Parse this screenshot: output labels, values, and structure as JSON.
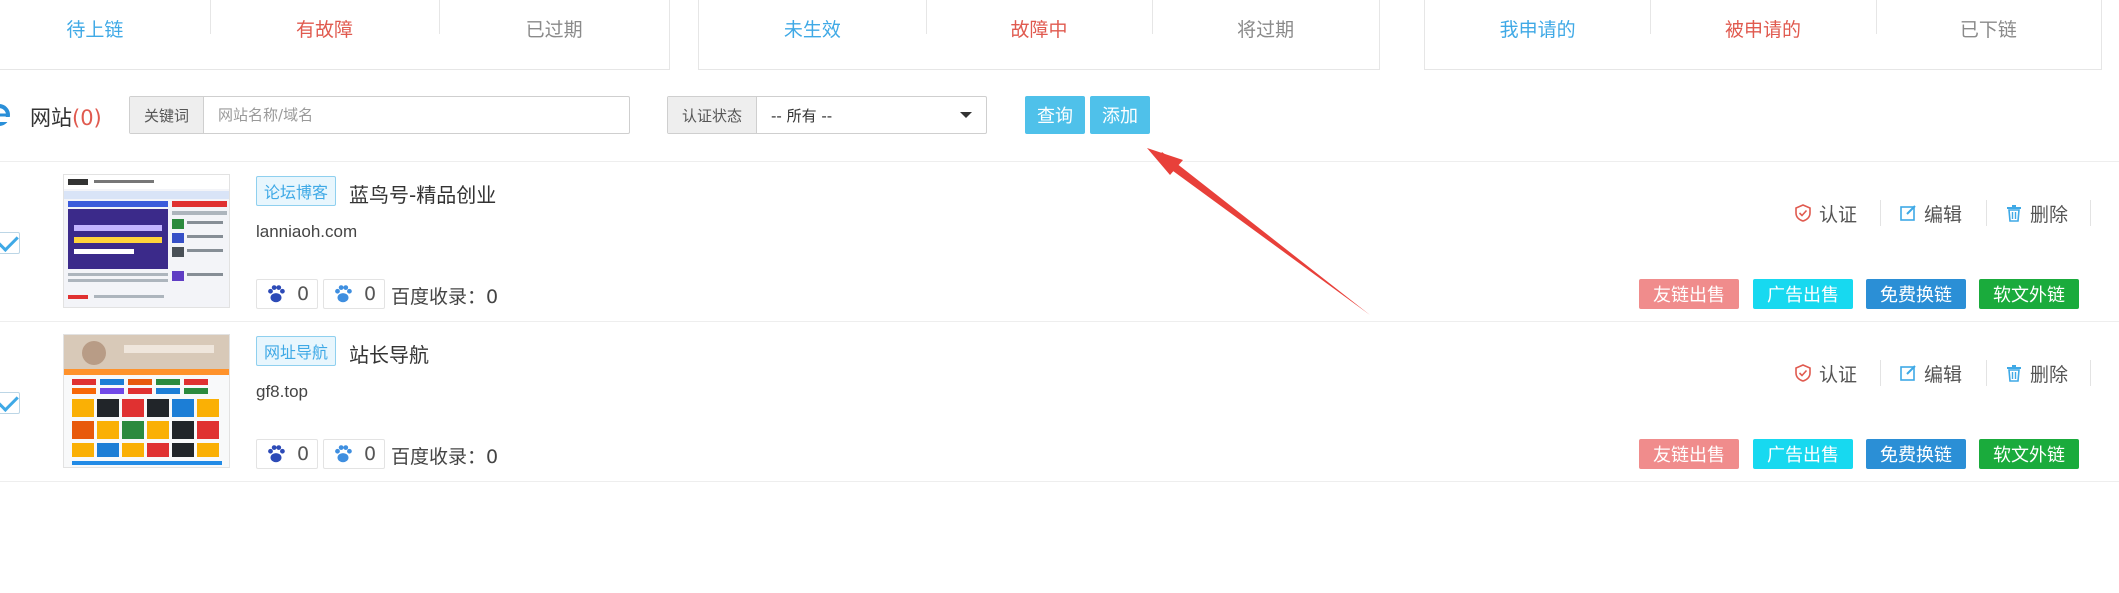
{
  "status_panels": [
    {
      "items": [
        {
          "label": "待上链",
          "color": "#3fa9e6"
        },
        {
          "label": "有故障",
          "color": "#e05a4f"
        },
        {
          "label": "已过期",
          "color": "#8a8a8a"
        }
      ]
    },
    {
      "items": [
        {
          "label": "未生效",
          "color": "#3fa9e6"
        },
        {
          "label": "故障中",
          "color": "#e05a4f"
        },
        {
          "label": "将过期",
          "color": "#8a8a8a"
        }
      ]
    },
    {
      "items": [
        {
          "label": "我申请的",
          "color": "#3fa9e6"
        },
        {
          "label": "被申请的",
          "color": "#e05a4f"
        },
        {
          "label": "已下链",
          "color": "#8a8a8a"
        }
      ]
    }
  ],
  "toolbar": {
    "title": "网站",
    "count": "(0)",
    "keyword_label": "关键词",
    "keyword_placeholder": "网站名称/域名",
    "status_label": "认证状态",
    "status_value": "-- 所有 --",
    "query_label": "查询",
    "add_label": "添加"
  },
  "sites": [
    {
      "tag": "论坛博客",
      "name": "蓝鸟号-精品创业",
      "domain": "lanniaoh.com",
      "paw_count_1": "0",
      "paw_count_2": "0",
      "baidu_label": "百度收录：",
      "baidu_count": "0",
      "cert_label": "认证",
      "edit_label": "编辑",
      "delete_label": "删除",
      "buttons": [
        "友链出售",
        "广告出售",
        "免费换链",
        "软文外链"
      ]
    },
    {
      "tag": "网址导航",
      "name": "站长导航",
      "domain": "gf8.top",
      "paw_count_1": "0",
      "paw_count_2": "0",
      "baidu_label": "百度收录：",
      "baidu_count": "0",
      "cert_label": "认证",
      "edit_label": "编辑",
      "delete_label": "删除",
      "buttons": [
        "友链出售",
        "广告出售",
        "免费换链",
        "软文外链"
      ]
    }
  ],
  "colors": {
    "primary_button": "#4fc1ea",
    "chip_pink": "#f08c8c",
    "chip_cyan": "#17d9f0",
    "chip_blue": "#2b8fd6",
    "chip_green": "#1aab3c",
    "arrow": "#e8403a"
  },
  "icons": {
    "site": "ie-logo-icon",
    "cert": "shield-check-icon",
    "edit": "edit-icon",
    "delete": "trash-icon",
    "paw": "baidu-paw-icon"
  }
}
